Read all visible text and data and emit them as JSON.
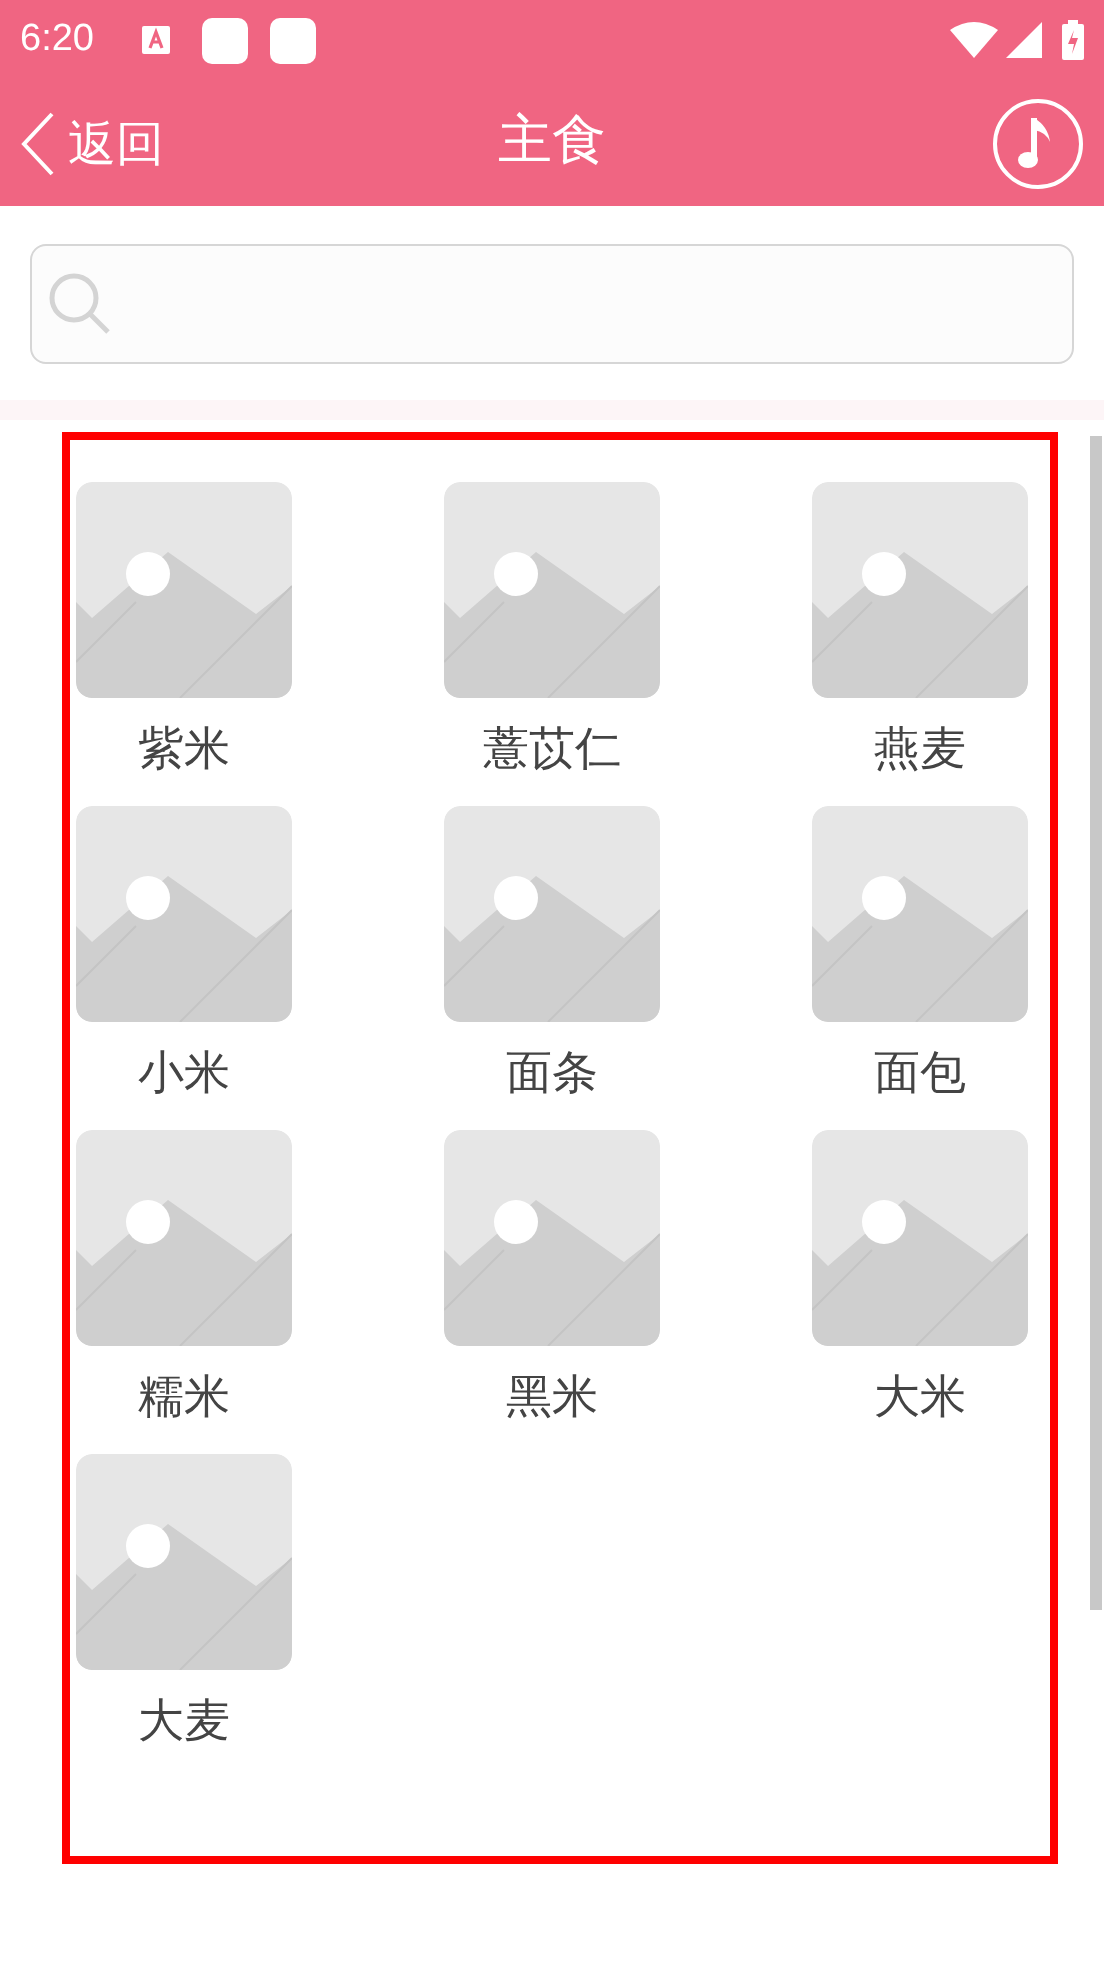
{
  "status_bar": {
    "time": "6:20"
  },
  "header": {
    "back": "返回",
    "title": "主食"
  },
  "items": [
    {
      "label": "紫米"
    },
    {
      "label": "薏苡仁"
    },
    {
      "label": "燕麦"
    },
    {
      "label": "小米"
    },
    {
      "label": "面条"
    },
    {
      "label": "面包"
    },
    {
      "label": "糯米"
    },
    {
      "label": "黑米"
    },
    {
      "label": "大米"
    },
    {
      "label": "大麦"
    }
  ]
}
